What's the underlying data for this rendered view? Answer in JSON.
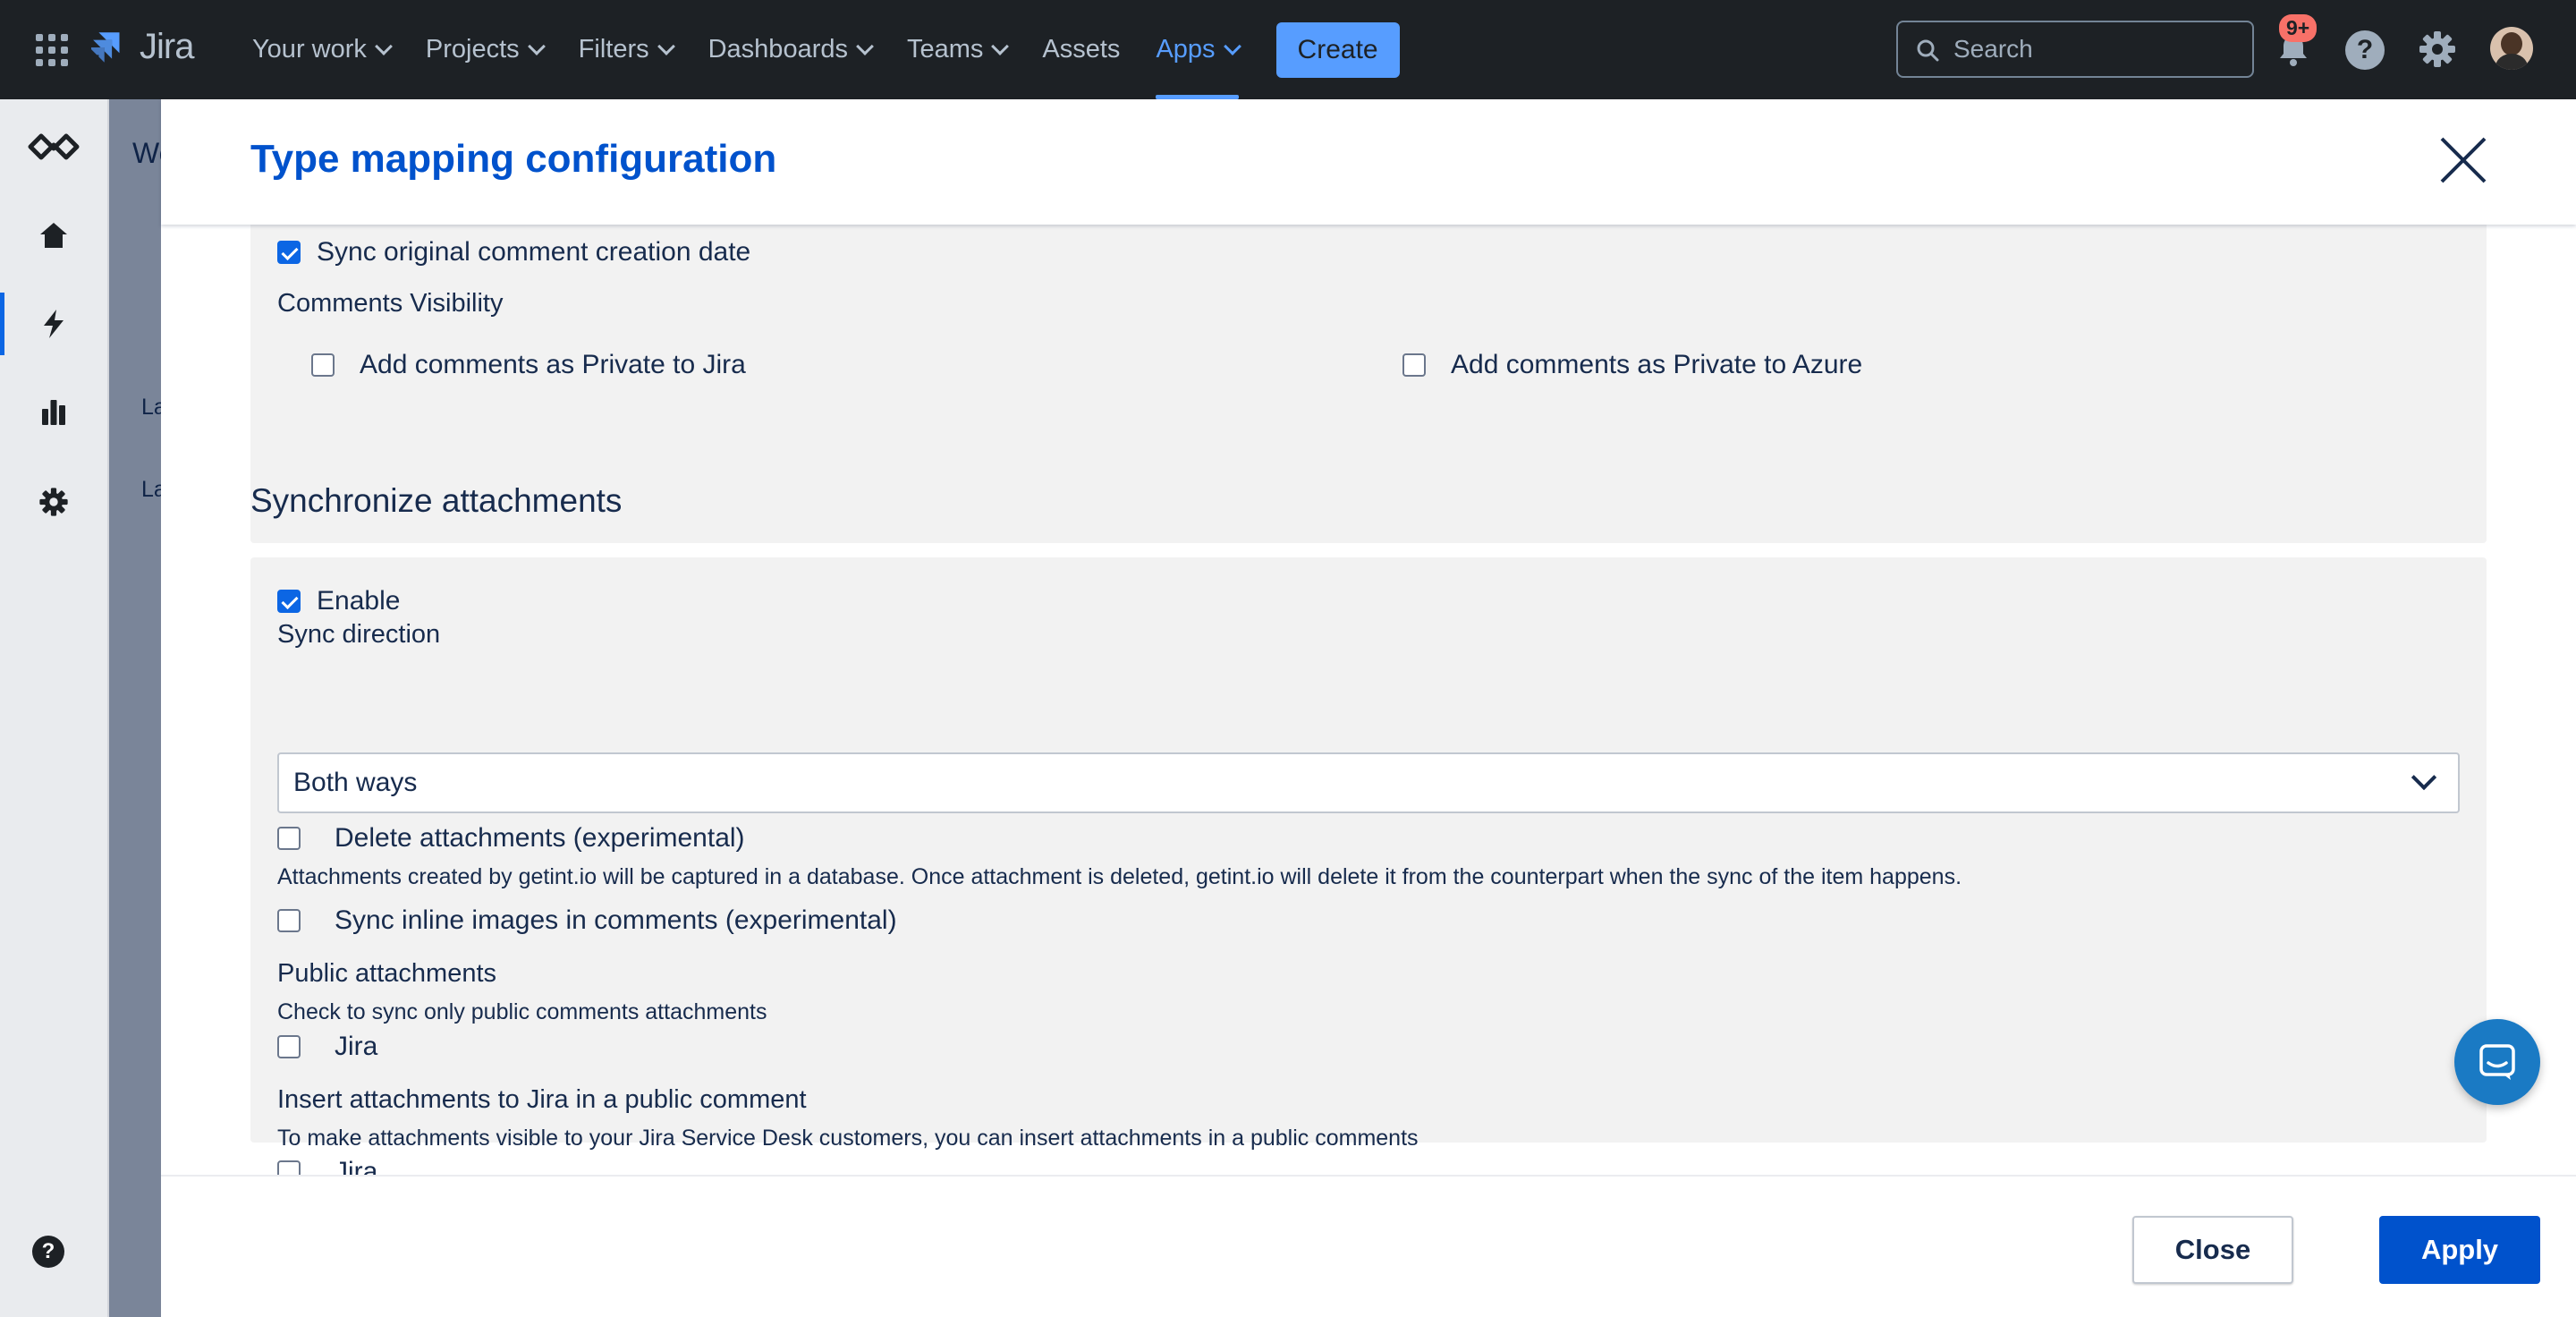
{
  "topnav": {
    "app_name": "Jira",
    "items": [
      {
        "label": "Your work",
        "dropdown": true
      },
      {
        "label": "Projects",
        "dropdown": true
      },
      {
        "label": "Filters",
        "dropdown": true
      },
      {
        "label": "Dashboards",
        "dropdown": true
      },
      {
        "label": "Teams",
        "dropdown": true
      },
      {
        "label": "Assets",
        "dropdown": false
      },
      {
        "label": "Apps",
        "dropdown": true,
        "active": true
      }
    ],
    "create_label": "Create",
    "search_placeholder": "Search",
    "notifications_badge": "9+",
    "help_glyph": "?"
  },
  "sidebar": {
    "icons": [
      "getint-logo-icon",
      "home-icon",
      "bolt-icon",
      "bar-chart-icon",
      "gear-icon"
    ],
    "help_glyph": "?"
  },
  "background": {
    "title_fragment": "We",
    "row1_fragment": "La",
    "row2_fragment": "La"
  },
  "modal": {
    "title": "Type mapping configuration",
    "comments": {
      "sync_creation_date_label": "Sync original comment creation date",
      "sync_creation_date_checked": true,
      "visibility_heading": "Comments Visibility",
      "private_jira_label": "Add comments as Private to Jira",
      "private_jira_checked": false,
      "private_azure_label": "Add comments as Private to Azure",
      "private_azure_checked": false
    },
    "attachments": {
      "section_title": "Synchronize attachments",
      "enable_label": "Enable",
      "enable_checked": true,
      "sync_direction_label": "Sync direction",
      "sync_direction_value": "Both ways",
      "delete_label": "Delete attachments (experimental)",
      "delete_checked": false,
      "delete_help": "Attachments created by getint.io will be captured in a database. Once attachment is deleted, getint.io will delete it from the counterpart when the sync of the item happens.",
      "inline_images_label": "Sync inline images in comments (experimental)",
      "inline_images_checked": false,
      "public_heading": "Public attachments",
      "public_help": "Check to sync only public comments attachments",
      "public_jira_label": "Jira",
      "public_jira_checked": false,
      "insert_heading": "Insert attachments to Jira in a public comment",
      "insert_help": "To make attachments visible to your Jira Service Desk customers, you can insert attachments in a public comments",
      "insert_jira_label": "Jira",
      "insert_jira_checked": false
    },
    "footer": {
      "close_label": "Close",
      "apply_label": "Apply"
    }
  },
  "colors": {
    "nav_bg": "#1d2125",
    "accent": "#579dff",
    "title_blue": "#0052cc",
    "panel_bg": "#f2f2f2",
    "checkbox_checked": "#0c66e4",
    "badge": "#f87168",
    "chat_bubble": "#1a7ac4"
  }
}
